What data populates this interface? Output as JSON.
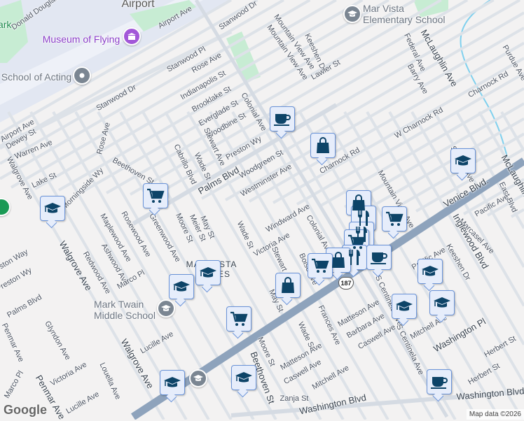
{
  "colors": {
    "background": "#f3f2f2",
    "airport": "#e2e7f2",
    "park": "#c7ecd3",
    "road": "#dde2e8",
    "highway": "#8ea3bc",
    "marker_fill": "#e6edfb",
    "marker_border": "#6a93d8",
    "icon": "#0d4468",
    "poi_purple": "#8a3ec8",
    "water": "#7fd0ee"
  },
  "pois": {
    "airport": "Airport",
    "museum": "Museum of Flying",
    "acting": "School of Acting",
    "park": "Park",
    "mar_vista_elem_1": "Mar Vista",
    "mar_vista_elem_2": "Elementary School",
    "mark_twain_1": "Mark Twain",
    "mark_twain_2": "Middle School",
    "neighborhood_1": "MAR VISTA",
    "neighborhood_2": "ES"
  },
  "streets": [
    "Donald Douglas",
    "Airport Ave",
    "Stanwood Dr",
    "Stanwood Pl",
    "Rose Ave",
    "Indianapolis St",
    "Brooklake St",
    "Everglade St",
    "Woodbine St",
    "Colonial Ave",
    "Stanwood Dr",
    "Airport Ave",
    "Dewey St",
    "Warren Ave",
    "Rose Ave",
    "Walgrove Ave",
    "Lake St",
    "Morningside Wy",
    "Beethoven St",
    "Cabrillo Blvd",
    "Wade St",
    "Stewart Ave",
    "Preston Wy",
    "Palms Blvd",
    "Woodgreen St",
    "Westminster Ave",
    "Mountain View Ave",
    "Keeshen Dr",
    "Lawler St",
    "Federal Ave",
    "McLaughlin Ave",
    "Barry Ave",
    "Charnock Rd",
    "Purdue Ave",
    "W Charnock Rd",
    "Charnock Rd",
    "Mountain View Ave",
    "S Barry Ave",
    "Venice Blvd.",
    "McLaughlin Ave",
    "East Blvd",
    "Pacific Ave",
    "Marcasel Ave",
    "Inglewood Blvd",
    "Pacific Ave",
    "Keeshen Dr",
    "Windward Ave",
    "Colonial Ave",
    "Victoria Ave",
    "Wade St",
    "May St",
    "Meier St",
    "Moore St",
    "Maplewood Ave",
    "Rosewood Ave",
    "Greenwood Ave",
    "Ashwood Ave",
    "Redwood Ave",
    "Marco Pl",
    "Walgrove Ave",
    "Preston Way",
    "Preston Wy",
    "Palms Blvd",
    "Glyndon Ave",
    "Penmar Ave",
    "Lucille Ave",
    "Victoria Ave",
    "Louella Ave",
    "Walgrove Ave",
    "Lucille Ave",
    "Marco Pl",
    "Penmar Ave",
    "Beethoven St",
    "Moore St",
    "Wade St",
    "Frances Ave",
    "Matteson Ave",
    "Matteson Ave",
    "Barbara Ave",
    "Caswell Ave",
    "Caswell Ave",
    "Mitchell Ave",
    "Mitchell Ave",
    "Washington Pl",
    "S Centinela Ave",
    "S Centinela Ave",
    "Herbert St",
    "Herbert St",
    "Zanja St",
    "Washington Blvd",
    "Washington Blvd",
    "Boise Ave",
    "Stewart Ave",
    "May St",
    "Mountain View Ave"
  ],
  "route_shield": "187",
  "markers": [
    "coffee",
    "bag",
    "school",
    "school",
    "cart",
    "bag",
    "restaurant",
    "cart",
    "restaurant",
    "cart",
    "restaurant",
    "coffee",
    "bag",
    "cart",
    "bag",
    "school",
    "school",
    "cart",
    "school",
    "school",
    "school",
    "school",
    "school",
    "coffee"
  ],
  "logo": "Google",
  "attribution": "Map data ©2026"
}
